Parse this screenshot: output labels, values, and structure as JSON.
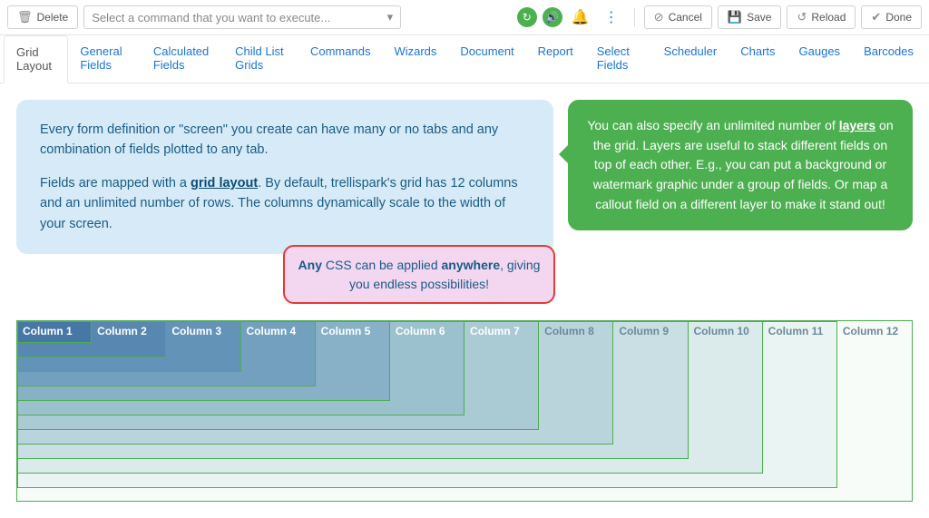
{
  "toolbar": {
    "delete_label": "Delete",
    "command_placeholder": "Select a command that you want to execute...",
    "cancel_label": "Cancel",
    "save_label": "Save",
    "reload_label": "Reload",
    "done_label": "Done"
  },
  "tabs": [
    {
      "label": "Grid Layout",
      "active": true
    },
    {
      "label": "General Fields"
    },
    {
      "label": "Calculated Fields"
    },
    {
      "label": "Child List Grids"
    },
    {
      "label": "Commands"
    },
    {
      "label": "Wizards"
    },
    {
      "label": "Document"
    },
    {
      "label": "Report"
    },
    {
      "label": "Select Fields"
    },
    {
      "label": "Scheduler"
    },
    {
      "label": "Charts"
    },
    {
      "label": "Gauges"
    },
    {
      "label": "Barcodes"
    }
  ],
  "info": {
    "para1": "Every form definition or \"screen\" you create can have many or no tabs and any combination of fields plotted to any tab.",
    "para2a": "Fields are mapped with a ",
    "para2_link": "grid layout",
    "para2b": ". By default, trellispark's grid has 12 columns and an unlimited number of rows. The columns dynamically scale to the width of your screen."
  },
  "tip": {
    "text_a": "You can also specify an unlimited number of ",
    "link": "layers",
    "text_b": " on the grid. Layers are useful to stack different fields on top of each other. E.g., you can put a background or watermark graphic under a group of fields. Or map a callout field on a different layer to make it stand out!"
  },
  "css_note": {
    "b1": "Any",
    "t1": " CSS can be applied ",
    "b2": "anywhere",
    "t2": ", giving you endless possibilities!"
  },
  "columns": [
    "Column 1",
    "Column 2",
    "Column 3",
    "Column 4",
    "Column 5",
    "Column 6",
    "Column 7",
    "Column 8",
    "Column 9",
    "Column 10",
    "Column 11",
    "Column 12"
  ]
}
